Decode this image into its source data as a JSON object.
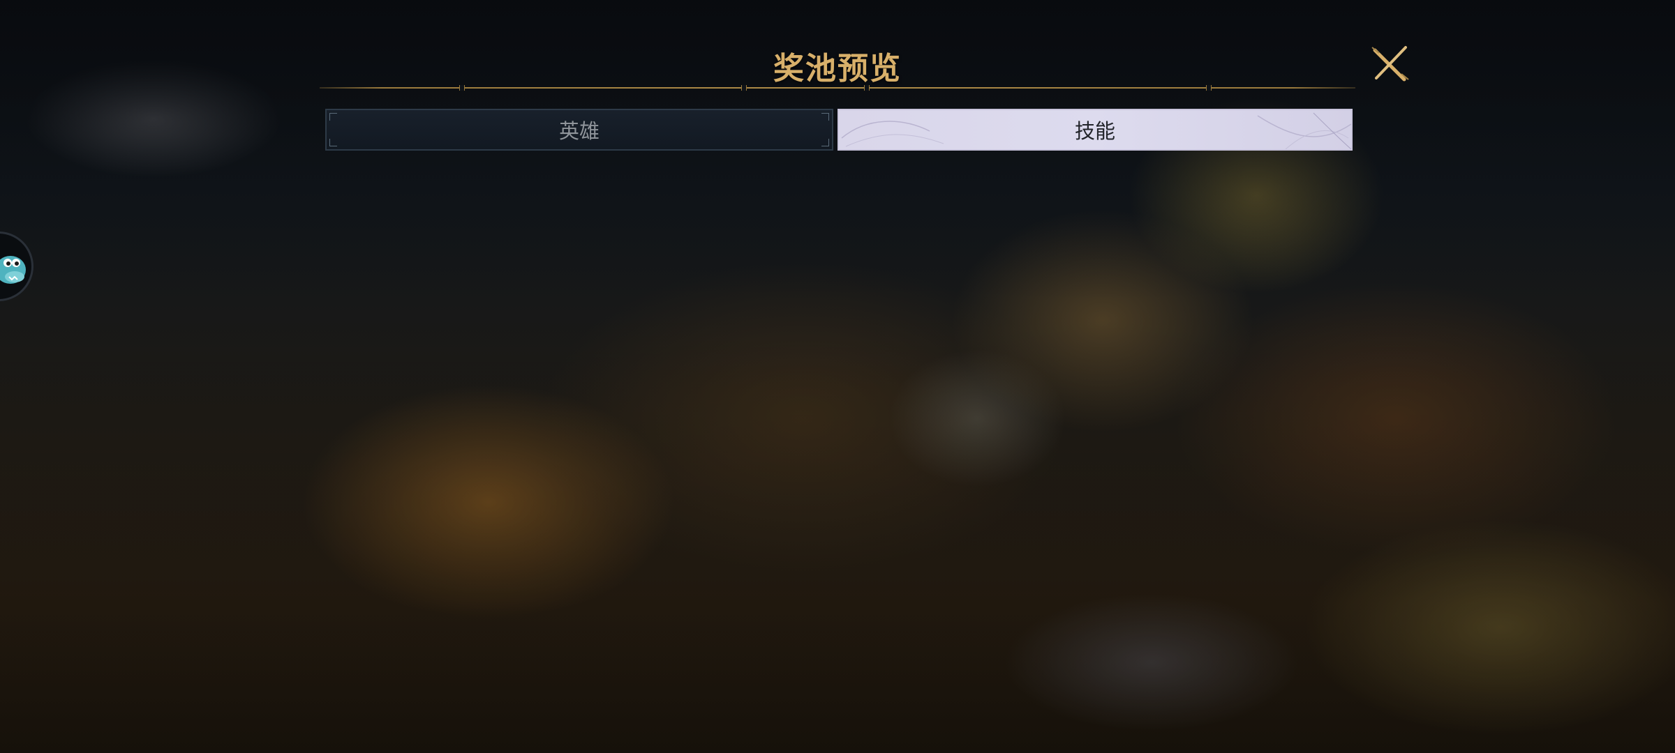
{
  "header": {
    "title": "奖池预览",
    "close_icon": "close-x-icon"
  },
  "tabs": [
    {
      "label": "英雄",
      "selected": false
    },
    {
      "label": "技能",
      "selected": true
    }
  ],
  "side_widget": {
    "icon": "dinosaur-mascot-icon"
  },
  "colors": {
    "title_gold": "#d8b06a",
    "divider_gold": "#b08d48",
    "tab_inactive_bg": "#18202b",
    "tab_active_bg": "#dddbee",
    "tab_inactive_text": "#8f949a",
    "tab_active_text": "#22242a",
    "mascot_teal": "#4fb3bf"
  }
}
